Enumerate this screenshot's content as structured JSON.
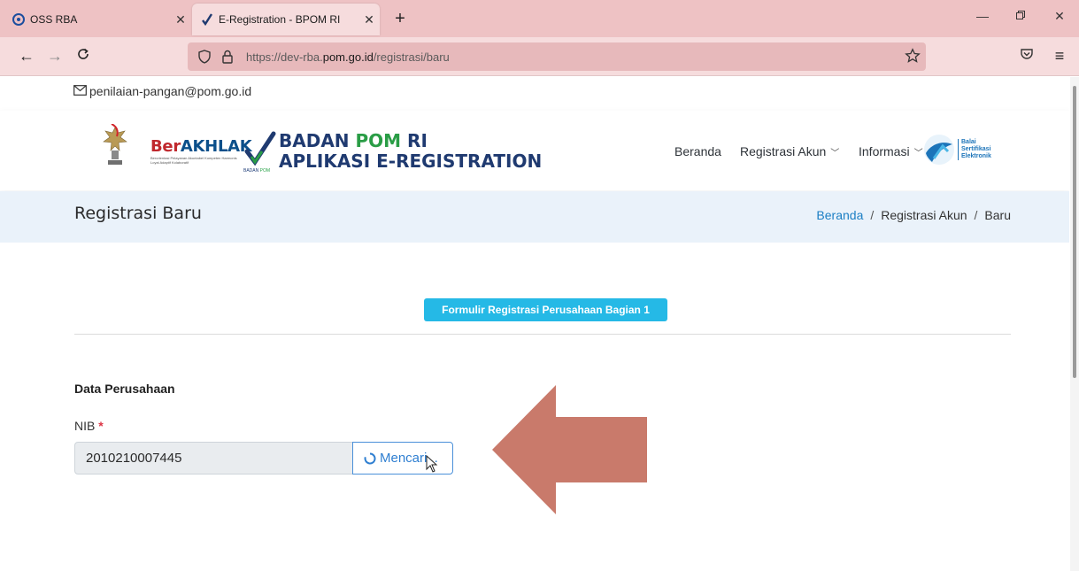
{
  "browser": {
    "tabs": [
      {
        "title": "OSS RBA",
        "active": false
      },
      {
        "title": "E-Registration - BPOM RI",
        "active": true
      }
    ],
    "new_tab_label": "+",
    "url": {
      "prefix": "https://dev-rba.",
      "domain": "pom.go.id",
      "path": "/registrasi/baru"
    }
  },
  "topbar": {
    "email": "penilaian-pangan@pom.go.id"
  },
  "header": {
    "berakhlak": {
      "main_red": "Ber",
      "main_blue": "AKHLAK",
      "tagline": "Berorientasi Pelayanan Akuntabel Kompeten Harmonis Loyal Adaptif Kolaboratif"
    },
    "bpom_small": {
      "a": "BADAN",
      "b": "POM"
    },
    "brand_line1_a": "BADAN ",
    "brand_line1_b": "POM",
    "brand_line1_c": " RI",
    "brand_line2": "APLIKASI E-REGISTRATION",
    "menu": [
      {
        "label": "Beranda",
        "dropdown": false
      },
      {
        "label": "Registrasi Akun",
        "dropdown": true
      },
      {
        "label": "Informasi",
        "dropdown": true
      }
    ],
    "bse": {
      "line1": "Balai",
      "line2": "Sertifikasi",
      "line3": "Elektronik"
    }
  },
  "page_title": "Registrasi Baru",
  "breadcrumb": {
    "items": [
      "Beranda",
      "Registrasi Akun",
      "Baru"
    ],
    "separator": "/"
  },
  "form": {
    "badge": "Formulir Registrasi Perusahaan Bagian 1",
    "section_title": "Data Perusahaan",
    "nib_label": "NIB",
    "required_mark": "*",
    "nib_value": "2010210007445",
    "search_button": "Mencari..."
  },
  "colors": {
    "chrome": "#eec2c4",
    "accent_blue": "#25b9e6",
    "link_blue": "#1c7fc4",
    "annotation_arrow": "#c97a6b",
    "required_red": "#dc3545"
  }
}
